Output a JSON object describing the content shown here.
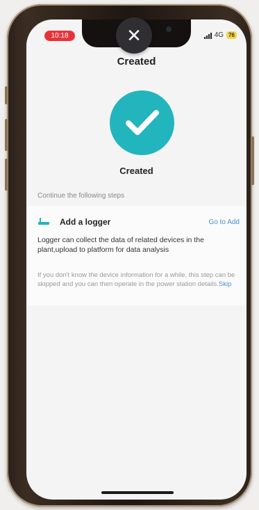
{
  "status_bar": {
    "time": "10:18",
    "network": "4G",
    "battery": "76"
  },
  "overlay": {
    "close_glyph": "✕"
  },
  "header": {
    "title": "Created"
  },
  "result": {
    "label": "Created",
    "accent": "#23b5bd"
  },
  "steps": {
    "intro": "Continue the following steps",
    "items": [
      {
        "title": "Add a logger",
        "action": "Go to Add",
        "description": "Logger can collect the data of related devices in the plant,upload to platform for data analysis",
        "note": "If you don't know the device information for a while, this step can be skipped and you can then operate in the power station details.",
        "skip_label": "Skip"
      }
    ]
  },
  "colors": {
    "link": "#4a8fd4",
    "time_pill": "#e5353a"
  }
}
